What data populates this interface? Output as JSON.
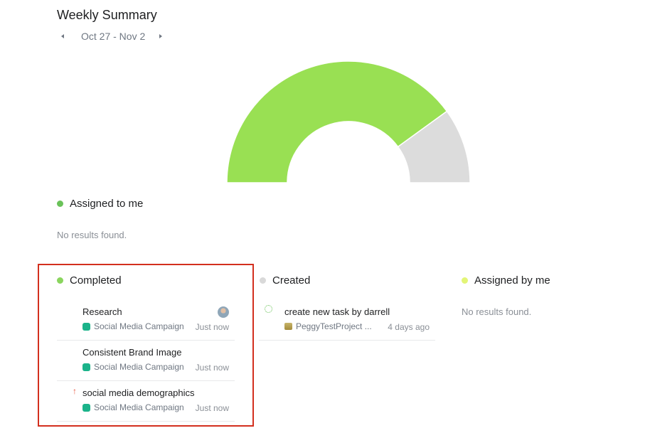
{
  "header": {
    "title": "Weekly Summary",
    "date_range": "Oct 27 - Nov 2",
    "prev_icon": "caret-left-icon",
    "next_icon": "caret-right-icon"
  },
  "donut": {
    "completed_fraction": 0.8,
    "completed_color": "#99e053",
    "remaining_color": "#dcdcdc"
  },
  "assigned_to_me": {
    "label": "Assigned to me",
    "dot_color": "#6ac259",
    "empty_text": "No results found."
  },
  "completed": {
    "label": "Completed",
    "dot_color": "#8ad55e",
    "tasks": [
      {
        "name": "Research",
        "project": "Social Media Campaign",
        "project_color": "#1bb38a",
        "time": "Just now",
        "indicator": "avatar"
      },
      {
        "name": "Consistent Brand Image",
        "project": "Social Media Campaign",
        "project_color": "#1bb38a",
        "time": "Just now",
        "indicator": ""
      },
      {
        "name": "social media demographics",
        "project": "Social Media Campaign",
        "project_color": "#1bb38a",
        "time": "Just now",
        "indicator": "↑"
      }
    ]
  },
  "created": {
    "label": "Created",
    "dot_color": "#d9d9d9",
    "tasks": [
      {
        "name": "create new task by darrell",
        "project": "PeggyTestProject ...",
        "time": "4 days ago",
        "indicator": "spinner"
      }
    ]
  },
  "assigned_by_me": {
    "label": "Assigned by me",
    "dot_color": "#e3f577",
    "empty_text": "No results found."
  }
}
